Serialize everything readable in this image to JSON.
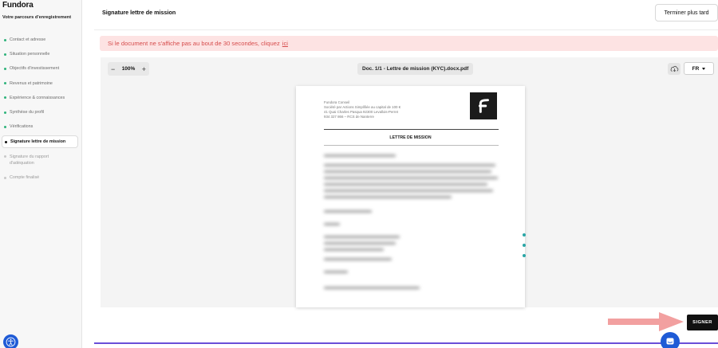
{
  "sidebar": {
    "brand": "Fundora",
    "subtitle": "Votre parcours d'enregistrement",
    "steps": [
      {
        "label": "Contact et adresse",
        "status": "done"
      },
      {
        "label": "Situation personnelle",
        "status": "done"
      },
      {
        "label": "Objectifs d'investissement",
        "status": "done"
      },
      {
        "label": "Revenus et patrimoine",
        "status": "done"
      },
      {
        "label": "Expérience & connaissances",
        "status": "done"
      },
      {
        "label": "Synthèse du profil",
        "status": "done"
      },
      {
        "label": "Vérifications",
        "status": "done"
      },
      {
        "label": "Signature lettre de mission",
        "status": "active"
      },
      {
        "label": "Signature du rapport d'adéquation",
        "status": "pending"
      },
      {
        "label": "Compte finalisé",
        "status": "pending"
      }
    ]
  },
  "header": {
    "title": "Signature lettre de mission",
    "finish_label": "Terminer plus tard"
  },
  "alert": {
    "text": "Si le document ne s'affiche pas au bout de 30 secondes, cliquez",
    "link": "ici"
  },
  "viewer": {
    "zoom": "100%",
    "zoom_out": "−",
    "zoom_in": "+",
    "doc_name": "Doc. 1/1 - Lettre de mission (KYC).docx.pdf",
    "language": "FR",
    "document": {
      "company_lines": [
        "Fundora Conseil",
        "Société par Actions Simplifiée au capital de 100 €",
        "41 Quai Charles Pasqua 92300 Levallois-Perret",
        "934 327 866 – RCS de Nanterre"
      ],
      "heading": "LETTRE DE MISSION"
    }
  },
  "footer": {
    "sign_label": "SIGNER",
    "progress": 1.0
  },
  "colors": {
    "accent": "#6a4fd8",
    "alert_bg": "#fde3e3",
    "alert_text": "#d64c4c",
    "done_dot": "#2fb37b",
    "help_blue": "#1f5bd6",
    "arrow": "#f2a0a0"
  },
  "icons": {
    "help": "accessibility-icon",
    "download": "cloud-download-icon",
    "chat": "chat-icon"
  }
}
